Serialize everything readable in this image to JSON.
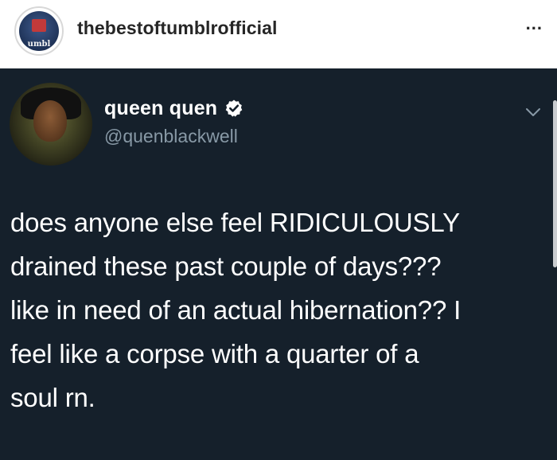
{
  "post_header": {
    "username": "thebestoftumblrofficial",
    "avatar_label": "umbl",
    "more_label": "..."
  },
  "tweet": {
    "display_name": "queen quen",
    "handle": "@quenblackwell",
    "verified": true,
    "text_lines": [
      "does anyone else feel RIDICULOUSLY",
      "drained these past couple of days???",
      "like in need of an actual hibernation?? I",
      "feel like a corpse with a quarter of a",
      "soul rn."
    ]
  },
  "colors": {
    "tweet_background": "#15202b",
    "handle_gray": "#8899a6",
    "verified_blue": "#ffffff"
  },
  "icons": {
    "more": "ellipsis-icon",
    "verified": "verified-badge-icon",
    "menu": "chevron-down-icon"
  }
}
